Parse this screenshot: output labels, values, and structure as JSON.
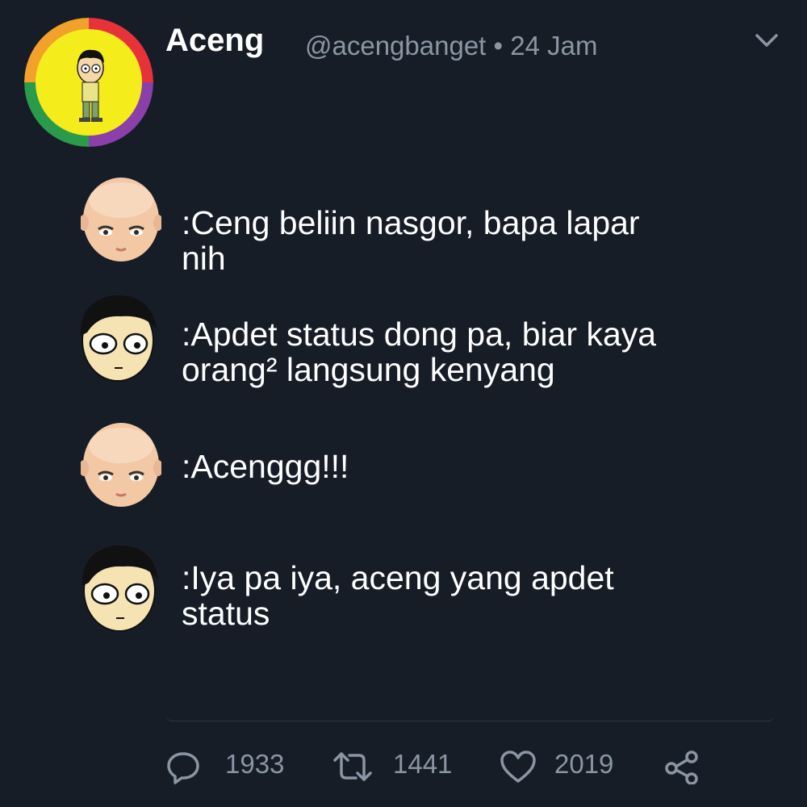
{
  "tweet": {
    "author_name": "Aceng",
    "handle_time": "@acengbanget • 24 Jam"
  },
  "messages": [
    {
      "speaker_icon": "boss-baby-face-icon",
      "text": ":Ceng beliin nasgor, bapa lapar\n nih"
    },
    {
      "speaker_icon": "aceng-face-icon",
      "text": ":Apdet status dong pa, biar kaya\n orang² langsung kenyang"
    },
    {
      "speaker_icon": "boss-baby-face-icon",
      "text": ":Acenggg!!!"
    },
    {
      "speaker_icon": "aceng-face-icon",
      "text": ":Iya pa iya, aceng yang apdet\n status"
    }
  ],
  "actions": {
    "reply_count": "1933",
    "retweet_count": "1441",
    "like_count": "2019"
  },
  "colors": {
    "background": "#161d27",
    "muted": "#8a96a3",
    "text": "#ffffff"
  }
}
